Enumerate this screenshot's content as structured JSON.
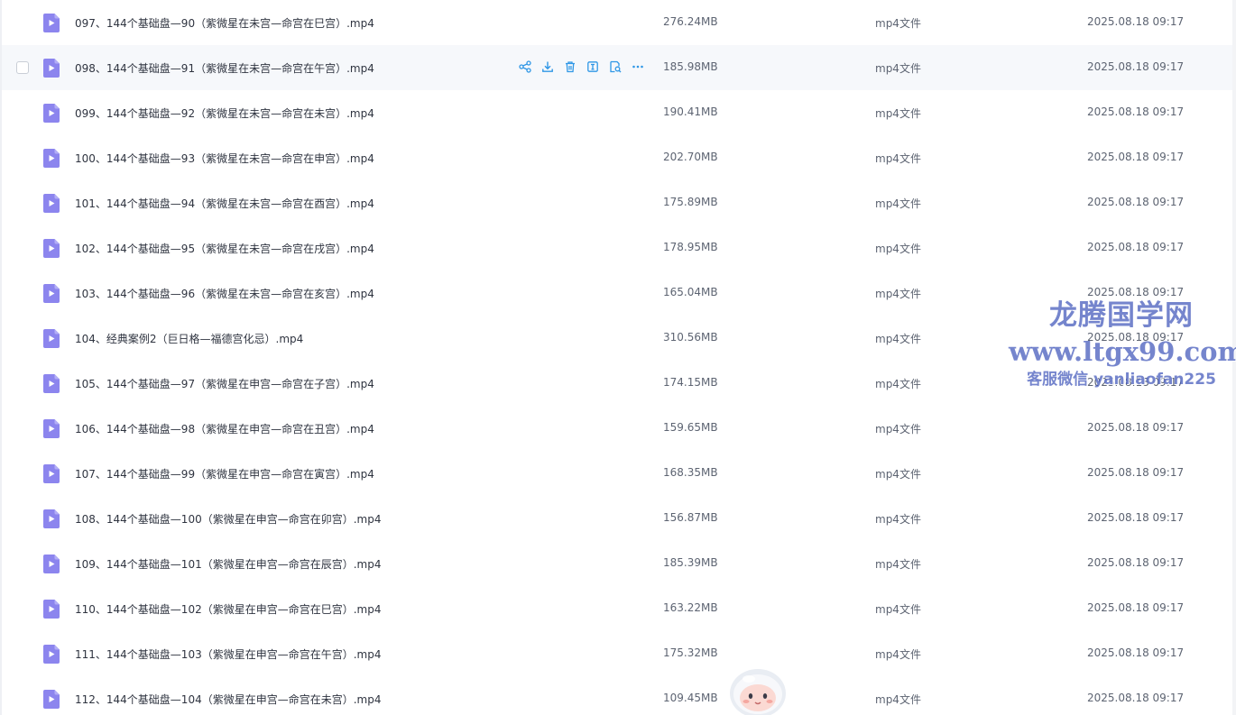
{
  "colors": {
    "icon": "#8c85ee",
    "action": "#2f97e6",
    "hover_row": "#f6f8fb",
    "watermark": "#4056ba"
  },
  "file_list": {
    "hover_row_index": 1,
    "actions": [
      "share-icon",
      "download-icon",
      "delete-icon",
      "rename-icon",
      "search-file-icon",
      "more-icon"
    ],
    "rows": [
      {
        "name": "097、144个基础盘—90（紫微星在未宫—命宫在巳宫）.mp4",
        "size": "276.24MB",
        "type": "mp4文件",
        "date": "2025.08.18 09:17"
      },
      {
        "name": "098、144个基础盘—91（紫微星在未宫—命宫在午宫）.mp4",
        "size": "185.98MB",
        "type": "mp4文件",
        "date": "2025.08.18 09:17"
      },
      {
        "name": "099、144个基础盘—92（紫微星在未宫—命宫在未宫）.mp4",
        "size": "190.41MB",
        "type": "mp4文件",
        "date": "2025.08.18 09:17"
      },
      {
        "name": "100、144个基础盘—93（紫微星在未宫—命宫在申宫）.mp4",
        "size": "202.70MB",
        "type": "mp4文件",
        "date": "2025.08.18 09:17"
      },
      {
        "name": "101、144个基础盘—94（紫微星在未宫—命宫在酉宫）.mp4",
        "size": "175.89MB",
        "type": "mp4文件",
        "date": "2025.08.18 09:17"
      },
      {
        "name": "102、144个基础盘—95（紫微星在未宫—命宫在戌宫）.mp4",
        "size": "178.95MB",
        "type": "mp4文件",
        "date": "2025.08.18 09:17"
      },
      {
        "name": "103、144个基础盘—96（紫微星在未宫—命宫在亥宫）.mp4",
        "size": "165.04MB",
        "type": "mp4文件",
        "date": "2025.08.18 09:17"
      },
      {
        "name": "104、经典案例2（巨日格—福德宫化忌）.mp4",
        "size": "310.56MB",
        "type": "mp4文件",
        "date": "2025.08.18 09:17"
      },
      {
        "name": "105、144个基础盘—97（紫微星在申宫—命宫在子宫）.mp4",
        "size": "174.15MB",
        "type": "mp4文件",
        "date": "2025.08.18 09:17"
      },
      {
        "name": "106、144个基础盘—98（紫微星在申宫—命宫在丑宫）.mp4",
        "size": "159.65MB",
        "type": "mp4文件",
        "date": "2025.08.18 09:17"
      },
      {
        "name": "107、144个基础盘—99（紫微星在申宫—命宫在寅宫）.mp4",
        "size": "168.35MB",
        "type": "mp4文件",
        "date": "2025.08.18 09:17"
      },
      {
        "name": "108、144个基础盘—100（紫微星在申宫—命宫在卯宫）.mp4",
        "size": "156.87MB",
        "type": "mp4文件",
        "date": "2025.08.18 09:17"
      },
      {
        "name": "109、144个基础盘—101（紫微星在申宫—命宫在辰宫）.mp4",
        "size": "185.39MB",
        "type": "mp4文件",
        "date": "2025.08.18 09:17"
      },
      {
        "name": "110、144个基础盘—102（紫微星在申宫—命宫在巳宫）.mp4",
        "size": "163.22MB",
        "type": "mp4文件",
        "date": "2025.08.18 09:17"
      },
      {
        "name": "111、144个基础盘—103（紫微星在申宫—命宫在午宫）.mp4",
        "size": "175.32MB",
        "type": "mp4文件",
        "date": "2025.08.18 09:17"
      },
      {
        "name": "112、144个基础盘—104（紫微星在申宫—命宫在未宫）.mp4",
        "size": "109.45MB",
        "type": "mp4文件",
        "date": "2025.08.18 09:17"
      }
    ]
  },
  "watermark": {
    "line1": "龙腾国学网",
    "line2": "www.ltgx99.com",
    "line3": "客服微信 yanliaofan225"
  }
}
